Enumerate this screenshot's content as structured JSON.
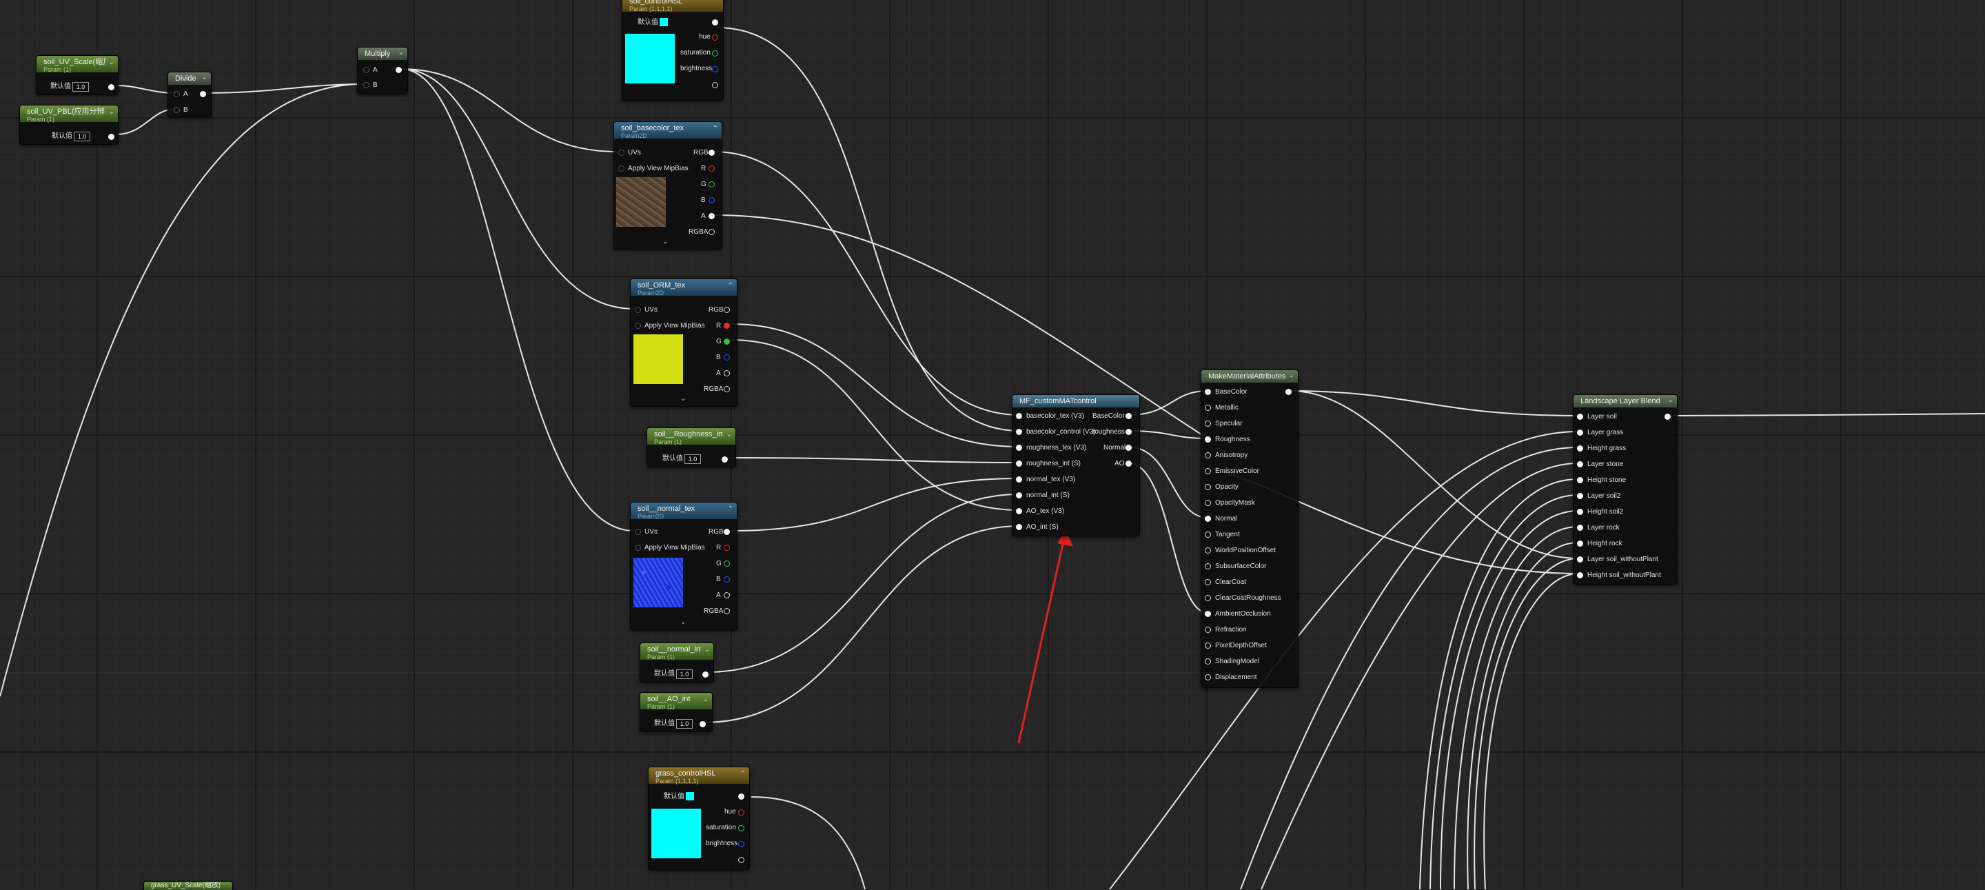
{
  "nodes": {
    "soil_uv_scale": {
      "title": "soil_UV_Scale(缩放)",
      "subtitle": "Param (1)",
      "default_label": "默认值",
      "value": "1.0"
    },
    "soil_uv_pbl": {
      "title": "soil_UV_PBL(应用分辨率)",
      "subtitle": "Param (1)",
      "default_label": "默认值",
      "value": "1.0"
    },
    "divide": {
      "title": "Divide",
      "pins": [
        "A",
        "B"
      ]
    },
    "multiply": {
      "title": "Multiply",
      "pins": [
        "A",
        "B"
      ]
    },
    "soil_control_hsl": {
      "title": "soil_controlHSL",
      "subtitle": "Param (1,1,1,1)",
      "default_label": "默认值",
      "outputs": [
        "hue",
        "saturation",
        "brightness"
      ],
      "swatch_color": "#00ffff"
    },
    "soil_basecolor_tex": {
      "title": "soil_basecolor_tex",
      "subtitle": "Param2D",
      "inputs": [
        "UVs",
        "Apply View MipBias"
      ],
      "outputs": [
        "RGB",
        "R",
        "G",
        "B",
        "A",
        "RGBA"
      ]
    },
    "soil_orm_tex": {
      "title": "soil_ORM_tex",
      "subtitle": "Param2D",
      "inputs": [
        "UVs",
        "Apply View MipBias"
      ],
      "outputs": [
        "RGB",
        "R",
        "G",
        "B",
        "A",
        "RGBA"
      ]
    },
    "soil_roughness_int": {
      "title": "soil__Roughness_int",
      "subtitle": "Param (1)",
      "default_label": "默认值",
      "value": "1.0"
    },
    "soil_normal_tex": {
      "title": "soil__normal_tex",
      "subtitle": "Param2D",
      "inputs": [
        "UVs",
        "Apply View MipBias"
      ],
      "outputs": [
        "RGB",
        "R",
        "G",
        "B",
        "A",
        "RGBA"
      ]
    },
    "soil_normal_int": {
      "title": "soil__normal_int",
      "subtitle": "Param (1)",
      "default_label": "默认值",
      "value": "1.0"
    },
    "soil_ao_int": {
      "title": "soil__AO_int",
      "subtitle": "Param (1)",
      "default_label": "默认值",
      "value": "1.0"
    },
    "grass_control_hsl": {
      "title": "grass_controlHSL",
      "subtitle": "Param (1,1,1,1)",
      "default_label": "默认值",
      "outputs": [
        "hue",
        "saturation",
        "brightness"
      ],
      "swatch_color": "#00ffff"
    },
    "grass_uv_scale": {
      "title": "grass_UV_Scale(缩放)"
    },
    "mf_custom": {
      "title": "MF_customMATcontrol",
      "inputs": [
        "basecolor_tex (V3)",
        "basecolor_control (V3)",
        "roughness_tex (V3)",
        "roughness_int (S)",
        "normal_tex (V3)",
        "normal_int (S)",
        "AO_tex (V3)",
        "AO_int (S)"
      ],
      "outputs": [
        "BaseColor",
        "roughness",
        "Normal",
        "AO"
      ]
    },
    "make_material": {
      "title": "MakeMaterialAttributes",
      "inputs": [
        "BaseColor",
        "Metallic",
        "Specular",
        "Roughness",
        "Anisotropy",
        "EmissiveColor",
        "Opacity",
        "OpacityMask",
        "Normal",
        "Tangent",
        "WorldPositionOffset",
        "SubsurfaceColor",
        "ClearCoat",
        "ClearCoatRoughness",
        "AmbientOcclusion",
        "Refraction",
        "PixelDepthOffset",
        "ShadingModel",
        "Displacement"
      ]
    },
    "landscape_blend": {
      "title": "Landscape Layer Blend",
      "inputs": [
        "Layer soil",
        "Layer grass",
        "Height grass",
        "Layer stone",
        "Height stone",
        "Layer soil2",
        "Height soil2",
        "Layer rock",
        "Height rock",
        "Layer soil_withoutPlant",
        "Height soil_withoutPlant"
      ]
    }
  },
  "colors": {
    "wire": "#e6e6e6",
    "annotation_arrow": "#e02020",
    "graph_bg": "#262626"
  },
  "icons": [
    "chevron-down-icon",
    "chevron-up-icon",
    "expand-icon"
  ]
}
